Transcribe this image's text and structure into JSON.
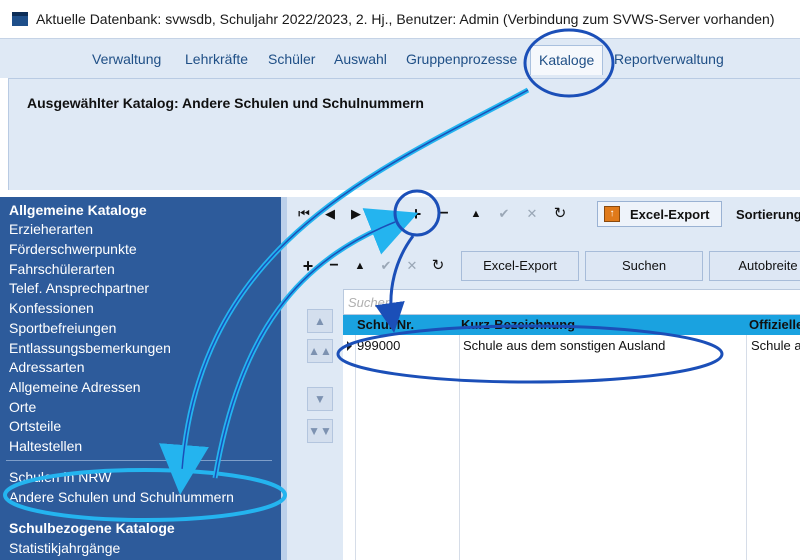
{
  "window": {
    "title": "Aktuelle Datenbank: svwsdb, Schuljahr 2022/2023, 2. Hj., Benutzer: Admin (Verbindung zum SVWS-Server vorhanden)"
  },
  "menu": {
    "items": [
      "Verwaltung",
      "Lehrkräfte",
      "Schüler",
      "Auswahl",
      "Gruppenprozesse",
      "Kataloge",
      "Reportverwaltung"
    ],
    "active": "Kataloge"
  },
  "catalog_header": {
    "title": "Ausgewählter Katalog: Andere Schulen und Schulnummern"
  },
  "sidebar": {
    "heading_general": "Allgemeine Kataloge",
    "items": [
      "Erzieherarten",
      "Förderschwerpunkte",
      "Fahrschülerarten",
      "Telef. Ansprechpartner",
      "Konfessionen",
      "Sportbefreiungen",
      "Entlassungsbemerkungen",
      "Adressarten",
      "Allgemeine Adressen",
      "Orte",
      "Ortsteile",
      "Haltestellen"
    ],
    "schools_nrw": "Schulen in NRW",
    "other_schools": "Andere Schulen und Schulnummern",
    "heading_school": "Schulbezogene Kataloge",
    "school_items": [
      "Statistikjahrgänge"
    ]
  },
  "toolbar": {
    "nav": {
      "first": "⏮",
      "prev": "◀",
      "next": "▶",
      "last": "⏭",
      "add": "+",
      "delete": "−",
      "up": "▲",
      "confirm": "✔",
      "cancel": "✕",
      "refresh": "↻"
    },
    "excel_export": "Excel-Export",
    "sort_label": "Sortierung"
  },
  "grid_toolbar": {
    "excel_export": "Excel-Export",
    "search": "Suchen",
    "auto_width": "Autobreite"
  },
  "search": {
    "placeholder": "Suchen"
  },
  "table": {
    "columns": [
      "Schul-Nr.",
      "Kurz-Bezeichnung",
      "Offizielle"
    ],
    "rows": [
      {
        "schulnr": "999000",
        "kurz": "Schule aus dem sonstigen Ausland",
        "offiziell": "Schule au"
      }
    ]
  },
  "colors": {
    "sidebar_bg": "#2d5b9b",
    "header_bg": "#1aa2e0",
    "annotation": "#1b4fb8",
    "annotation_arrow": "#24b4ef"
  }
}
